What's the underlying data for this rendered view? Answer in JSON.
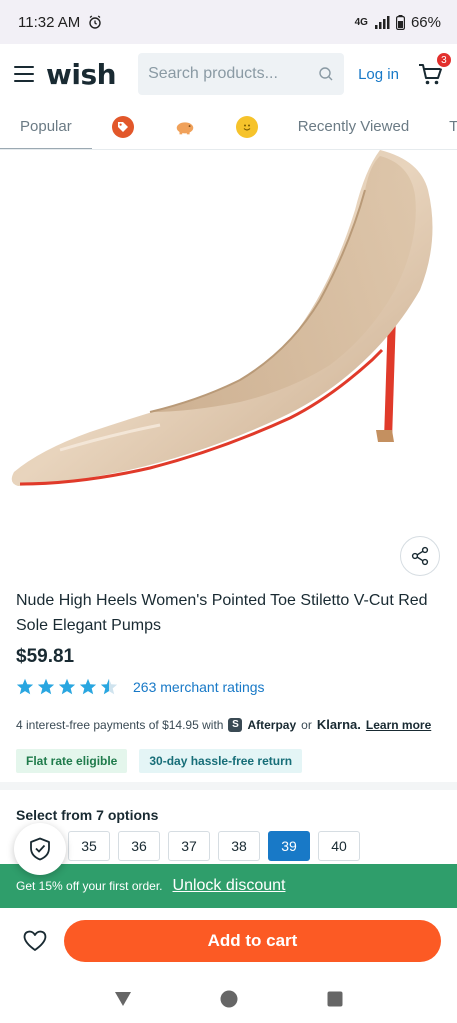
{
  "status_bar": {
    "time": "11:32 AM",
    "network": "4G",
    "battery": "66%"
  },
  "header": {
    "logo": "wish",
    "search_placeholder": "Search products...",
    "login_label": "Log in",
    "cart_count": "3"
  },
  "tabs": [
    {
      "label": "Popular",
      "active": true
    },
    {
      "label": "",
      "icon": "tag-icon",
      "color": "#e2572a"
    },
    {
      "label": "",
      "icon": "piggy-bank-icon",
      "color": "#f0a15a"
    },
    {
      "label": "",
      "icon": "emoji-icon",
      "color": "#f6c32b"
    },
    {
      "label": "Recently Viewed"
    },
    {
      "label": "Tr"
    }
  ],
  "product": {
    "title": "Nude High Heels Women's Pointed Toe Stiletto V-Cut Red Sole Elegant Pumps",
    "price": "$59.81",
    "rating_stars": 4.5,
    "rating_text": "263 merchant ratings",
    "installments_text": "4 interest-free payments of $14.95 with",
    "afterpay_icon": "S",
    "afterpay_label": "Afterpay",
    "or_label": "or",
    "klarna_label": "Klarna.",
    "learn_more": "Learn more",
    "badges": [
      "Flat rate eligible",
      "30-day hassle-free return"
    ]
  },
  "options": {
    "label": "Select from 7 options",
    "sizes": [
      {
        "label": "35",
        "selected": false
      },
      {
        "label": "36",
        "selected": false
      },
      {
        "label": "37",
        "selected": false
      },
      {
        "label": "38",
        "selected": false
      },
      {
        "label": "39",
        "selected": true
      },
      {
        "label": "40",
        "selected": false
      }
    ]
  },
  "promo": {
    "text": "Get 15% off your first order.",
    "link": "Unlock discount"
  },
  "bottom": {
    "add_to_cart": "Add to cart"
  },
  "colors": {
    "accent_blue": "#1879c7",
    "cta_orange": "#fc5a24",
    "promo_green": "#2f9e6b",
    "star_blue": "#29a6e0"
  }
}
